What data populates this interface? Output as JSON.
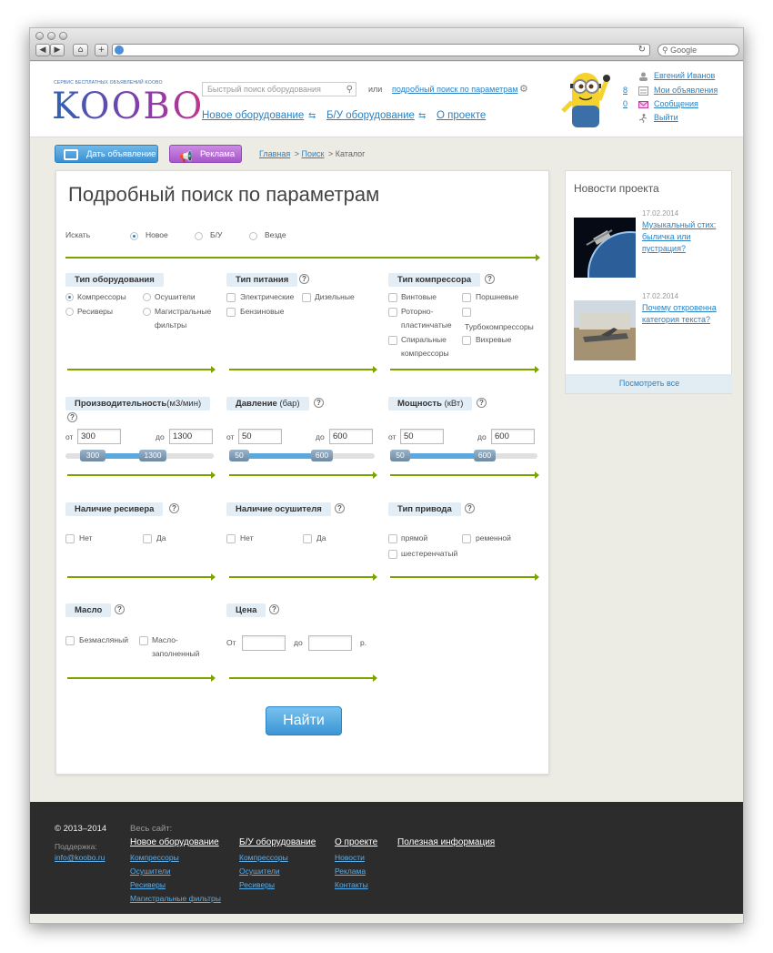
{
  "browser": {
    "search_placeholder": "Google"
  },
  "header": {
    "logo_tagline": "СЕРВИС БЕСПЛАТНЫХ ОБЪЯВЛЕНИЙ KOOBO",
    "logo_text": "KOOBO",
    "search_placeholder": "Быстрый поиск оборудования",
    "or_text": "или",
    "advanced_search_link": "подробный поиск по параметрам",
    "nav": [
      "Новое оборудование",
      "Б/У оборудование",
      "О проекте"
    ],
    "user": {
      "name": "Евгений Иванов",
      "ads_count": "8",
      "ads_label": "Мои объявления",
      "messages_count": "0",
      "messages_label": "Сообщения",
      "logout_label": "Выйти"
    }
  },
  "actions": {
    "post_ad": "Дать объявление",
    "ads": "Реклама"
  },
  "breadcrumb": [
    "Главная",
    "Поиск",
    "Каталог"
  ],
  "search": {
    "title": "Подробный поиск по параметрам",
    "scope_label": "Искать",
    "scope_options": [
      "Новое",
      "Б/У",
      "Везде"
    ],
    "scope_selected": "Новое",
    "equipment_type": {
      "label": "Тип оборудования",
      "options": [
        "Компрессоры",
        "Осушители",
        "Ресиверы",
        "Магистральные фильтры"
      ],
      "selected": "Компрессоры"
    },
    "power_type": {
      "label": "Тип питания",
      "options": [
        "Электрические",
        "Дизельные",
        "Бензиновые"
      ]
    },
    "compressor_type": {
      "label": "Тип компрессора",
      "options": [
        "Винтовые",
        "Поршневые",
        "Роторно-пластинчатые",
        "Турбокомпрессоры",
        "Спиральные компрессоры",
        "Вихревые"
      ]
    },
    "performance": {
      "label": "Производительность",
      "unit": "(м3/мин)",
      "from_label": "от",
      "to_label": "до",
      "from": "300",
      "to": "1300",
      "handle_min": "300",
      "handle_max": "1300"
    },
    "pressure": {
      "label": "Давление",
      "unit": "(бар)",
      "from_label": "от",
      "to_label": "до",
      "from": "50",
      "to": "600",
      "handle_min": "50",
      "handle_max": "600"
    },
    "power": {
      "label": "Мощность",
      "unit": "(кВт)",
      "from_label": "от",
      "to_label": "до",
      "from": "50",
      "to": "600",
      "handle_min": "50",
      "handle_max": "600"
    },
    "receiver": {
      "label": "Наличие ресивера",
      "options": [
        "Нет",
        "Да"
      ]
    },
    "dryer": {
      "label": "Наличие осушителя",
      "options": [
        "Нет",
        "Да"
      ]
    },
    "drive_type": {
      "label": "Тип привода",
      "options": [
        "прямой",
        "ременной",
        "шестеренчатый"
      ]
    },
    "oil": {
      "label": "Масло",
      "options": [
        "Безмасляный",
        "Масло-заполненный"
      ]
    },
    "price": {
      "label": "Цена",
      "from_label": "От",
      "to_label": "до",
      "currency": "р."
    },
    "submit": "Найти"
  },
  "news": {
    "title": "Новости проекта",
    "items": [
      {
        "date": "17.02.2014",
        "title": "Музыкальный стих: быличка или пустрация?"
      },
      {
        "date": "17.02.2014",
        "title": "Почему откровенна категория текста?"
      }
    ],
    "view_all": "Посмотреть все"
  },
  "footer": {
    "copyright": "© 2013–2014",
    "support_label": "Поддержка:",
    "support_email": "info@koobo.ru",
    "all_site": "Весь сайт:",
    "columns": [
      {
        "title": "Новое оборудование",
        "links": [
          "Компрессоры",
          "Осушители",
          "Ресиверы",
          "Магистральные фильтры"
        ]
      },
      {
        "title": "Б/У оборудование",
        "links": [
          "Компрессоры",
          "Осушители",
          "Ресиверы"
        ]
      },
      {
        "title": "О проекте",
        "links": [
          "Новости",
          "Реклама",
          "Контакты"
        ]
      },
      {
        "title": "Полезная информация",
        "links": []
      }
    ]
  }
}
